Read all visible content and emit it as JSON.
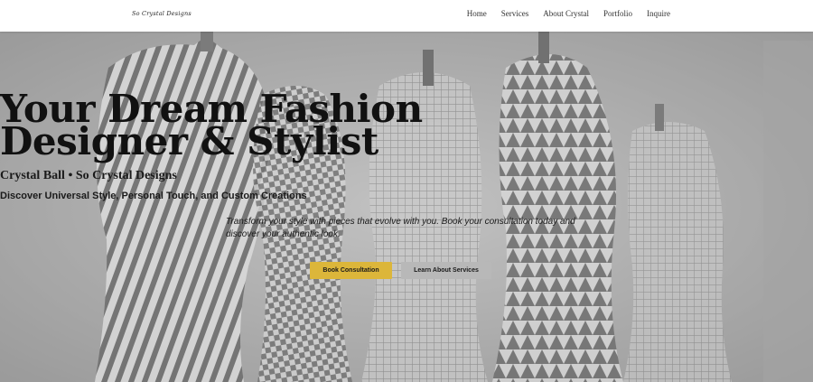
{
  "nav": {
    "logo": "So Crystal Designs",
    "items": [
      "Home",
      "Services",
      "About Crystal",
      "Portfolio",
      "Inquire"
    ]
  },
  "hero": {
    "title_line1": "Your Dream Fashion",
    "title_line2": "Designer & Stylist",
    "subtitle": "Crystal Ball • So Crystal Designs",
    "tagline": "Discover Universal Style, Personal Touch, and Custom Creations",
    "description": "Transform your style with pieces that evolve with you. Book your consultation today and discover your authentic look.",
    "primary_button": "Book Consultation",
    "secondary_button": "Learn About Services"
  },
  "colors": {
    "accent": "#dcb63a",
    "secondary_button": "#b8b8b8",
    "text": "#111111"
  }
}
